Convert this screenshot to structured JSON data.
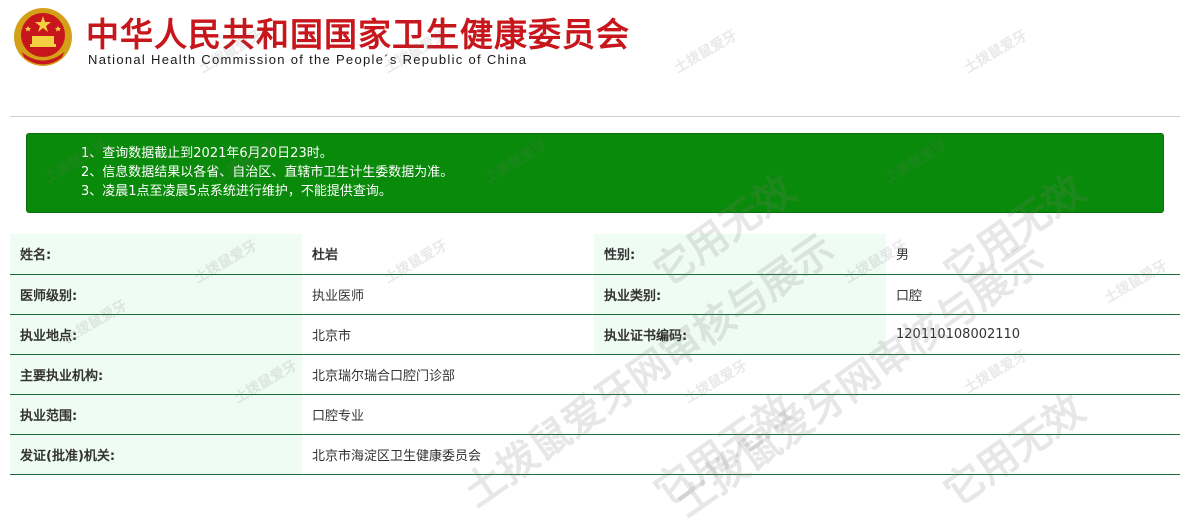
{
  "header": {
    "title_cn": "中华人民共和国国家卫生健康委员会",
    "title_en": "National Health Commission of the People´s Republic of China",
    "emblem_icon": "national-emblem-icon",
    "title_color": "#c8161d"
  },
  "notice": {
    "lines": [
      "1、查询数据截止到2021年6月20日23时。",
      "2、信息数据结果以各省、自治区、直辖市卫生计生委数据为准。",
      "3、凌晨1点至凌晨5点系统进行维护，不能提供查询。"
    ],
    "background": "#0a8a0a"
  },
  "record": {
    "name_label": "姓名:",
    "name_value": "杜岩",
    "gender_label": "性别:",
    "gender_value": "男",
    "level_label": "医师级别:",
    "level_value": "执业医师",
    "category_label": "执业类别:",
    "category_value": "口腔",
    "location_label": "执业地点:",
    "location_value": "北京市",
    "cert_label": "执业证书编码:",
    "cert_value": "120110108002110",
    "institution_label": "主要执业机构:",
    "institution_value": "北京瑞尔瑞合口腔门诊部",
    "scope_label": "执业范围:",
    "scope_value": "口腔专业",
    "issuer_label": "发证(批准)机关:",
    "issuer_value": "北京市海淀区卫生健康委员会"
  },
  "watermarks": {
    "small": "土拨鼠爱牙",
    "big_a": "土拨鼠爱牙网审核与展示",
    "big_b": "它用无效"
  }
}
